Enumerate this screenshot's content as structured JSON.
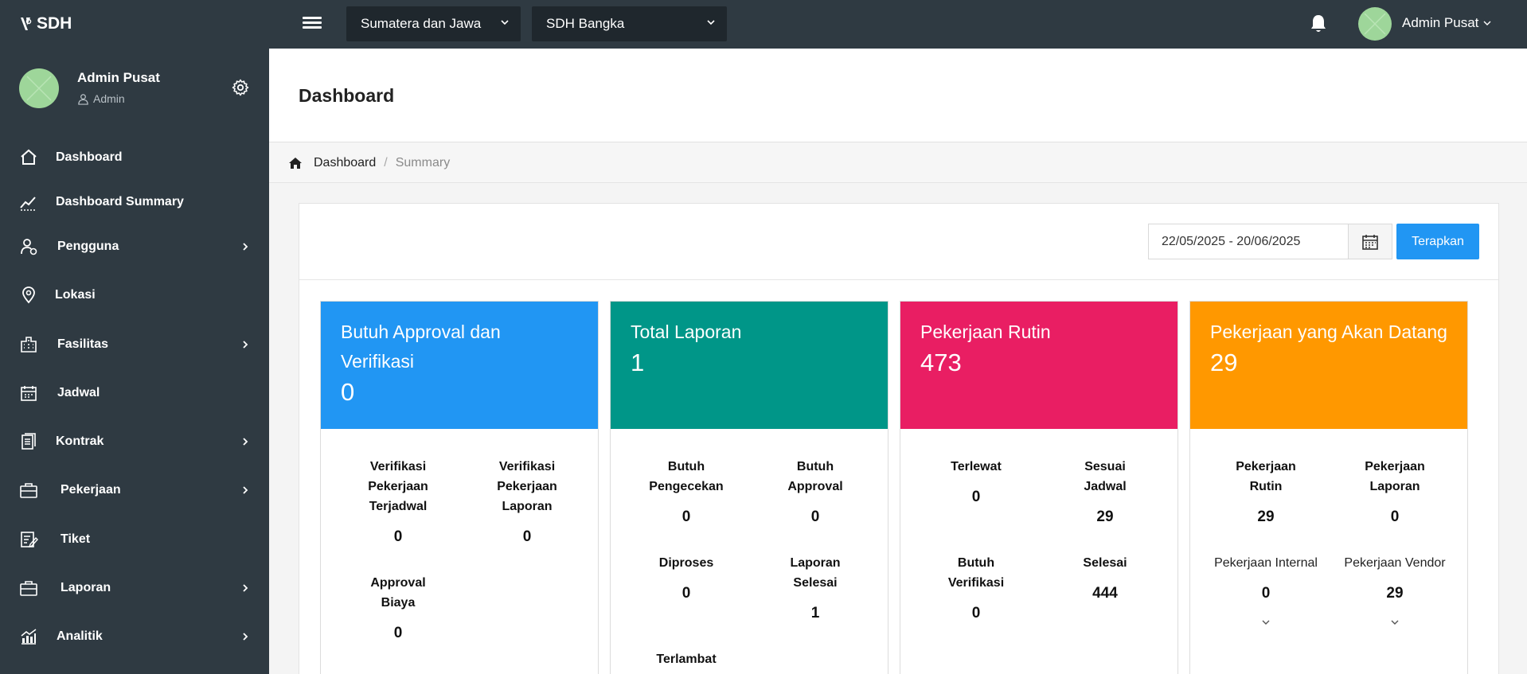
{
  "topbar": {
    "logo": "SDH",
    "region_select": "Sumatera dan Jawa",
    "site_select": "SDH Bangka",
    "user_name": "Admin Pusat"
  },
  "sidebar": {
    "user_name": "Admin Pusat",
    "user_role": "Admin",
    "items": [
      {
        "label": "Dashboard",
        "icon": "home-icon",
        "has_arrow": false
      },
      {
        "label": "Dashboard Summary",
        "icon": "chart-line-icon",
        "has_arrow": false
      },
      {
        "label": "Pengguna",
        "icon": "users-icon",
        "has_arrow": true
      },
      {
        "label": "Lokasi",
        "icon": "location-icon",
        "has_arrow": false
      },
      {
        "label": "Fasilitas",
        "icon": "building-icon",
        "has_arrow": true
      },
      {
        "label": "Jadwal",
        "icon": "calendar-icon",
        "has_arrow": false
      },
      {
        "label": "Kontrak",
        "icon": "document-icon",
        "has_arrow": true
      },
      {
        "label": "Pekerjaan",
        "icon": "briefcase-icon",
        "has_arrow": true
      },
      {
        "label": "Tiket",
        "icon": "ticket-icon",
        "has_arrow": false
      },
      {
        "label": "Laporan",
        "icon": "briefcase-icon",
        "has_arrow": true
      },
      {
        "label": "Analitik",
        "icon": "analytics-icon",
        "has_arrow": true
      }
    ]
  },
  "page": {
    "title": "Dashboard",
    "breadcrumb": [
      "Dashboard",
      "Summary"
    ],
    "breadcrumb_sep": "/"
  },
  "filter": {
    "date_range": "22/05/2025 - 20/06/2025",
    "apply_label": "Terapkan"
  },
  "colors": {
    "card1": "#2196f3",
    "card2": "#009688",
    "card3": "#e91e63",
    "card4": "#ff9800"
  },
  "cards": [
    {
      "title": "Butuh Approval dan Verifikasi",
      "value": "0",
      "stats": [
        {
          "label": "Verifikasi Pekerjaan Terjadwal",
          "value": "0"
        },
        {
          "label": "Verifikasi Pekerjaan Laporan",
          "value": "0"
        },
        {
          "label": "Approval Biaya",
          "value": "0"
        }
      ]
    },
    {
      "title": "Total Laporan",
      "value": "1",
      "stats": [
        {
          "label": "Butuh Pengecekan",
          "value": "0"
        },
        {
          "label": "Butuh Approval",
          "value": "0"
        },
        {
          "label": "Diproses",
          "value": "0"
        },
        {
          "label": "Laporan Selesai",
          "value": "1"
        },
        {
          "label": "Terlambat",
          "value": ""
        }
      ]
    },
    {
      "title": "Pekerjaan Rutin",
      "value": "473",
      "stats": [
        {
          "label": "Terlewat",
          "value": "0"
        },
        {
          "label": "Sesuai Jadwal",
          "value": "29"
        },
        {
          "label": "Butuh Verifikasi",
          "value": "0"
        },
        {
          "label": "Selesai",
          "value": "444"
        }
      ]
    },
    {
      "title": "Pekerjaan yang Akan Datang",
      "value": "29",
      "stats": [
        {
          "label": "Pekerjaan Rutin",
          "value": "29"
        },
        {
          "label": "Pekerjaan Laporan",
          "value": "0"
        },
        {
          "label": "Pekerjaan Internal",
          "value": "0"
        },
        {
          "label": "Pekerjaan Vendor",
          "value": "29"
        }
      ]
    }
  ]
}
